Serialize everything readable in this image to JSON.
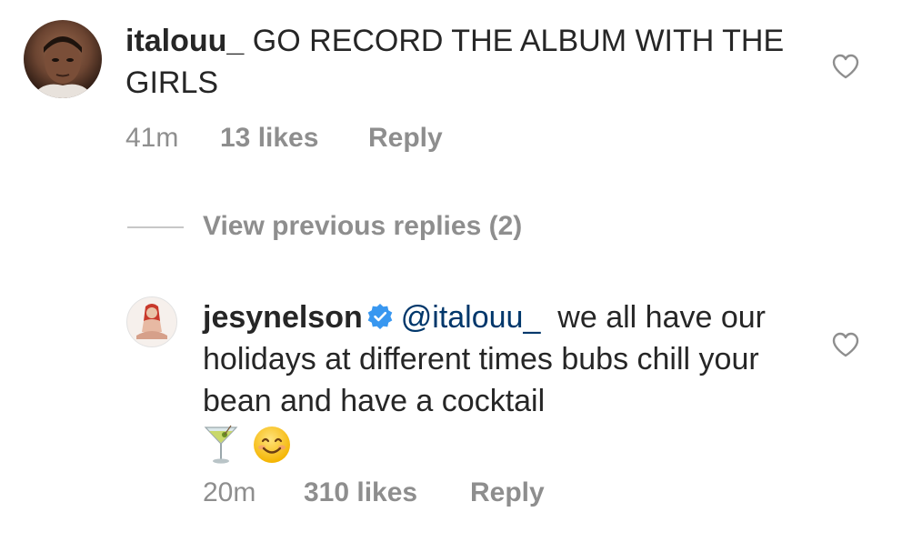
{
  "comments": [
    {
      "username": "italouu_",
      "verified": false,
      "text": "GO RECORD THE ALBUM WITH THE GIRLS",
      "time": "41m",
      "likes": "13 likes",
      "reply_label": "Reply",
      "heart_icon": "heart-outline-icon"
    },
    {
      "username": "jesynelson",
      "verified": true,
      "mention": "@italouu_",
      "text": "we all have our holidays at different times bubs chill your bean and have a cocktail",
      "emojis": [
        "🍸",
        "😊"
      ],
      "time": "20m",
      "likes": "310 likes",
      "reply_label": "Reply",
      "heart_icon": "heart-outline-icon"
    }
  ],
  "replies_toggle": {
    "label": "View previous replies (2)"
  },
  "colors": {
    "text": "#262626",
    "secondary": "#8e8e8e",
    "mention": "#00376b",
    "verified_badge": "#3897f0",
    "divider": "#c7c7c7"
  }
}
